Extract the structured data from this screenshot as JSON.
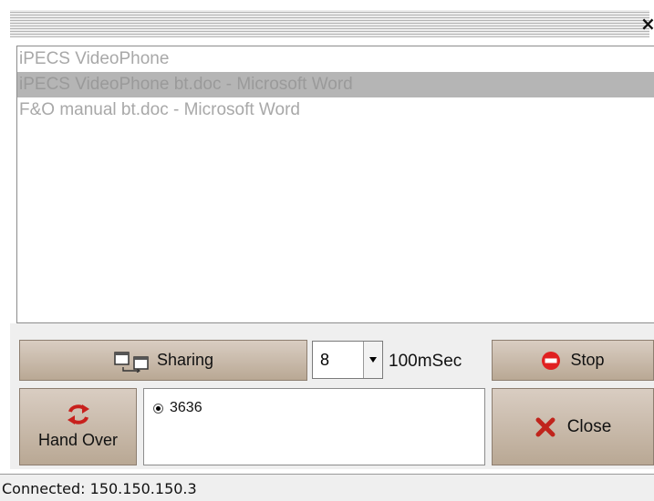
{
  "title_bar": {
    "close_glyph": "×"
  },
  "window_list": {
    "items": [
      {
        "label": "iPECS VideoPhone",
        "selected": false
      },
      {
        "label": "iPECS VideoPhone bt.doc - Microsoft Word",
        "selected": true
      },
      {
        "label": "F&O manual bt.doc - Microsoft Word",
        "selected": false
      }
    ]
  },
  "controls": {
    "sharing_label": "Sharing",
    "sharing_icon": "window-share-icon",
    "interval_value": "8",
    "interval_unit": "100mSec",
    "stop_label": "Stop",
    "stop_icon": "stop-icon",
    "handover_label": "Hand Over",
    "handover_icon": "refresh-icon",
    "close_label": "Close",
    "close_icon": "close-x-icon"
  },
  "users": [
    {
      "label": "3636",
      "selected": true
    }
  ],
  "status": {
    "text": "Connected: 150.150.150.3"
  },
  "colors": {
    "stop_red": "#e02020",
    "close_red": "#c0241c",
    "handover_red": "#c8201c",
    "button_tan": "#c4b4a2"
  }
}
